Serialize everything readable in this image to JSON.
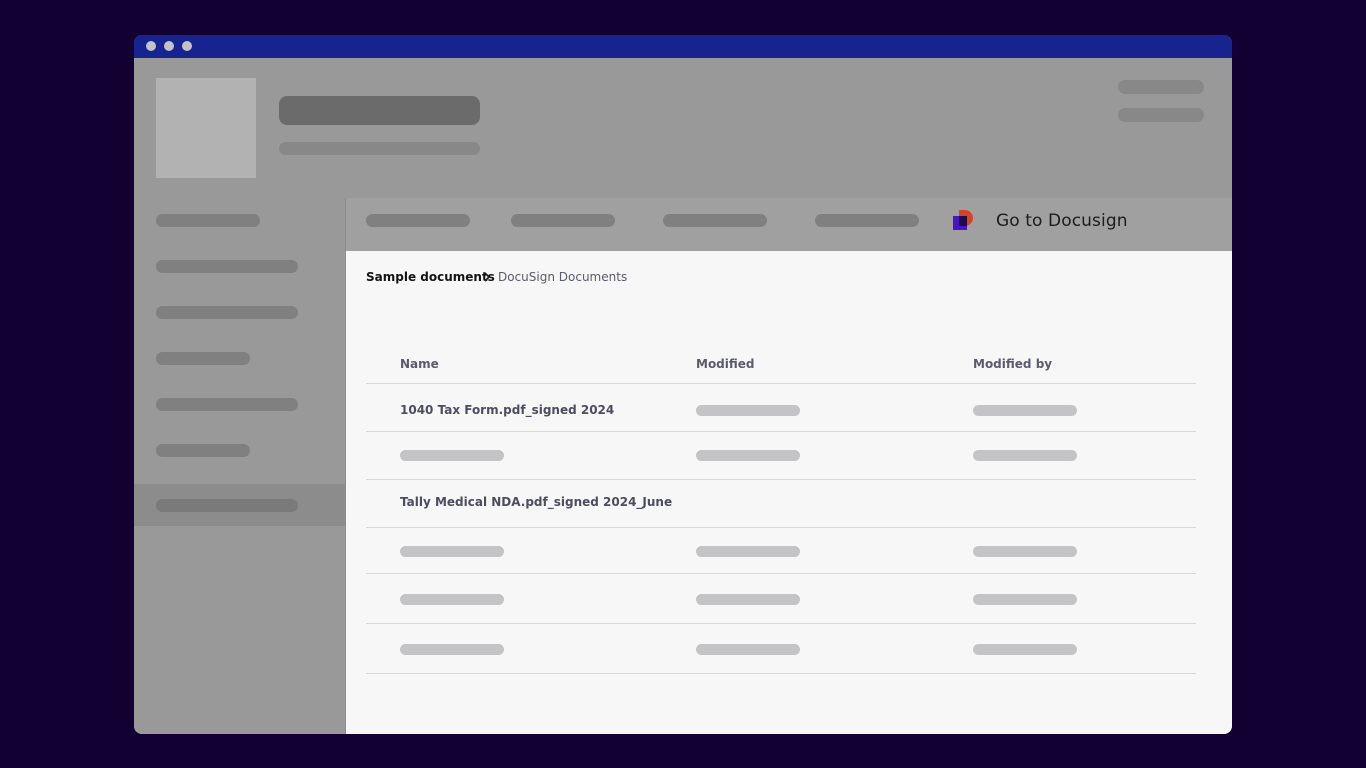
{
  "nav": {
    "cta_label": "Go to Docusign"
  },
  "breadcrumb": {
    "parent": "Sample documents",
    "current": "DocuSign Documents"
  },
  "table": {
    "columns": [
      "Name",
      "Modified",
      "Modified by"
    ],
    "rows": [
      {
        "name": "1040 Tax Form.pdf_signed 2024"
      },
      {
        "name": ""
      },
      {
        "name": "Tally Medical NDA.pdf_signed 2024_June"
      },
      {
        "name": ""
      },
      {
        "name": ""
      },
      {
        "name": ""
      }
    ]
  },
  "colors": {
    "page_background": "#130033",
    "titlebar": "#17238e",
    "docusign_red": "#d5432a",
    "docusign_purple": "#4a14c8"
  }
}
